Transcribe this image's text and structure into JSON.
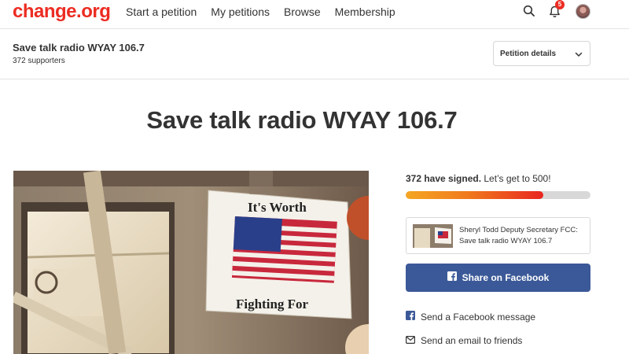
{
  "brand": {
    "logo_text": "change.org",
    "color": "#ec2c22"
  },
  "nav": {
    "links": [
      "Start a petition",
      "My petitions",
      "Browse",
      "Membership"
    ],
    "notification_count": "5",
    "icons": [
      "search-icon",
      "bell-icon",
      "avatar"
    ]
  },
  "petition_bar": {
    "title": "Save talk radio WYAY 106.7",
    "supporters": "372 supporters",
    "details_label": "Petition details"
  },
  "headline": "Save talk radio WYAY 106.7",
  "media": {
    "poster_line1": "It's Worth",
    "poster_line2": "Fighting For"
  },
  "signatures": {
    "signed_bold": "372 have signed.",
    "goal_text": " Let’s get to 500!",
    "progress_fraction": 0.744,
    "progress_colors": [
      "#f5a623",
      "#e8261f"
    ]
  },
  "update": {
    "text": "Sheryl Todd Deputy Secretary FCC: Save talk radio WYAY 106.7"
  },
  "share": {
    "facebook_label": "Share on Facebook",
    "facebook_color": "#3b5998",
    "fb_message_label": "Send a Facebook message",
    "email_label": "Send an email to friends"
  }
}
